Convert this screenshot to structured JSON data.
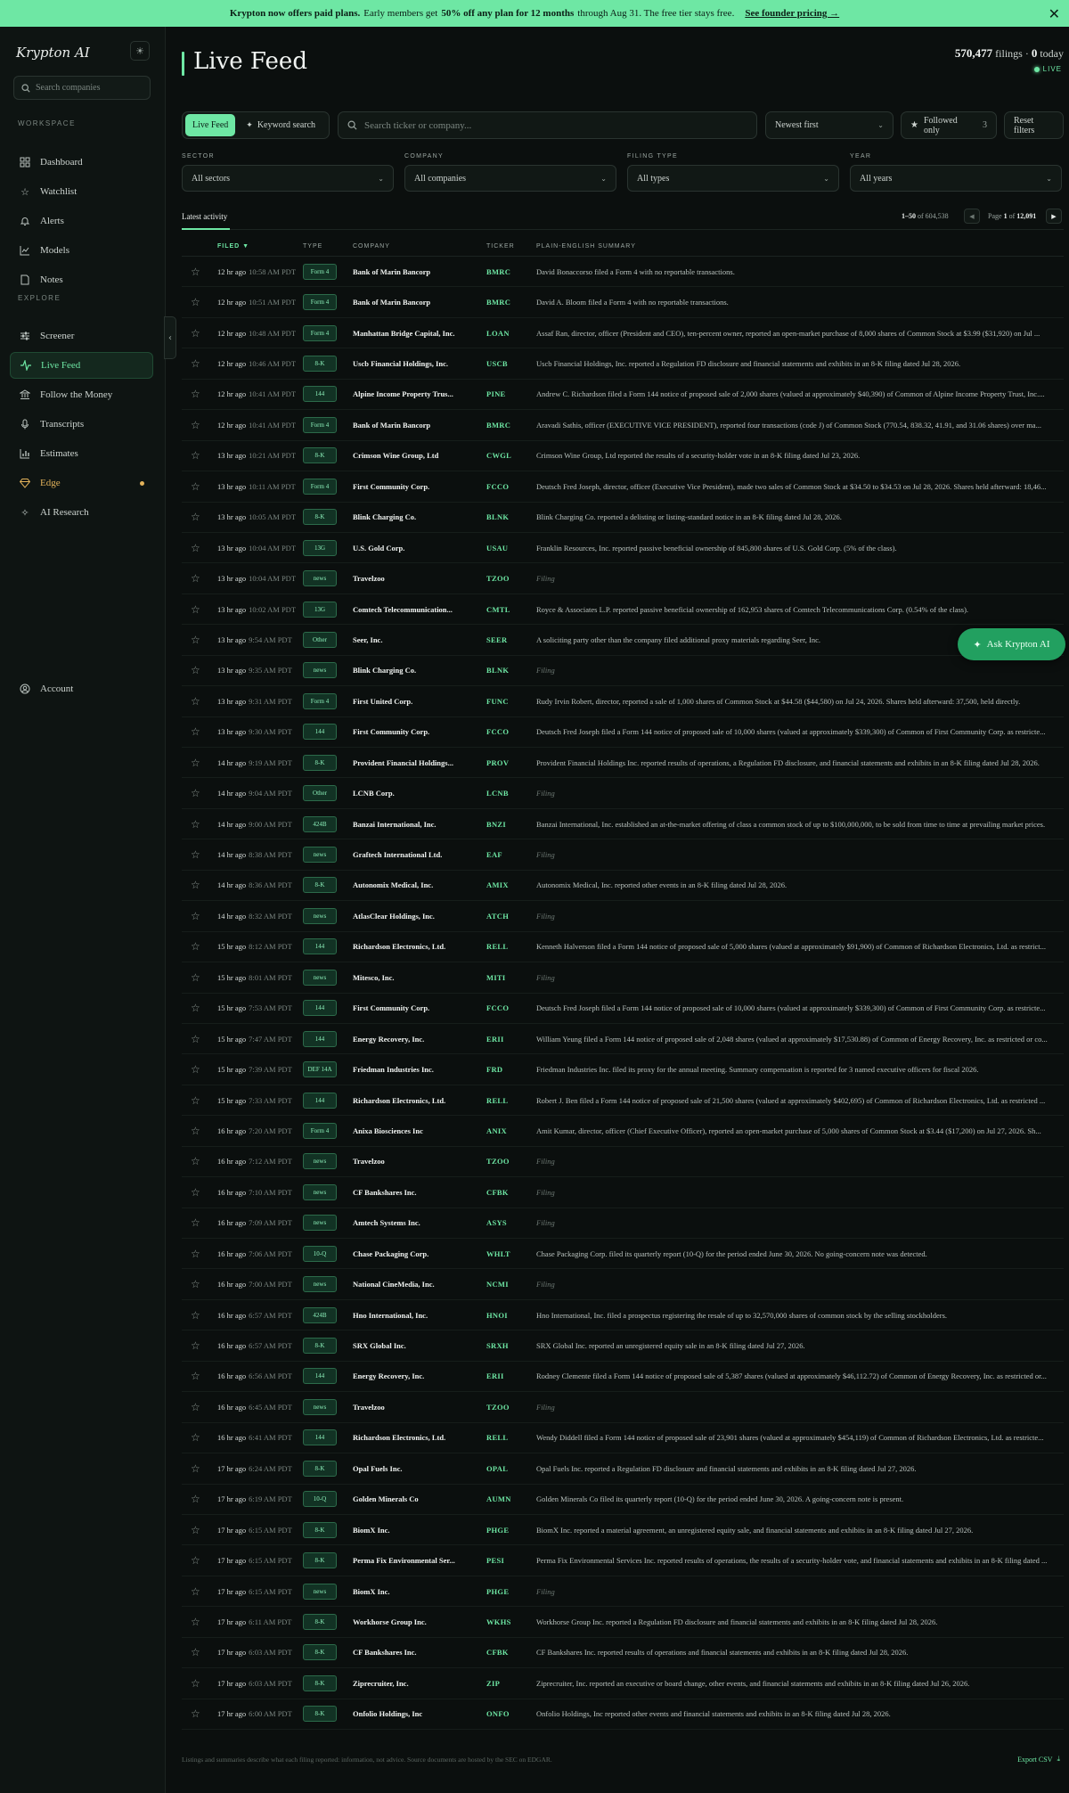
{
  "banner": {
    "lead": "Krypton now offers paid plans.",
    "text1": "Early members get",
    "highlight": "50% off any plan for 12 months",
    "text2": "through Aug 31. The free tier stays free.",
    "link": "See founder pricing →",
    "close": "✕"
  },
  "sidebar": {
    "logo": "Krypton AI",
    "search_placeholder": "Search companies",
    "workspace_label": "WORKSPACE",
    "explore_label": "EXPLORE",
    "workspace": [
      {
        "label": "Dashboard",
        "icon": "grid-icon"
      },
      {
        "label": "Watchlist",
        "icon": "star-icon"
      },
      {
        "label": "Alerts",
        "icon": "bell-icon"
      },
      {
        "label": "Models",
        "icon": "chart-line-icon"
      },
      {
        "label": "Notes",
        "icon": "note-icon"
      }
    ],
    "explore": [
      {
        "label": "Screener",
        "icon": "sliders-icon"
      },
      {
        "label": "Live Feed",
        "icon": "pulse-icon"
      },
      {
        "label": "Follow the Money",
        "icon": "bank-icon"
      },
      {
        "label": "Transcripts",
        "icon": "mic-icon"
      },
      {
        "label": "Estimates",
        "icon": "bar-chart-icon"
      },
      {
        "label": "Edge",
        "icon": "gem-icon"
      },
      {
        "label": "AI Research",
        "icon": "sparkle-icon"
      }
    ],
    "account": "Account"
  },
  "header": {
    "title": "Live Feed",
    "filings_count": "570,477",
    "filings_label": "filings ·",
    "today_count": "0",
    "today_label": "today",
    "live": "LIVE"
  },
  "toolbar": {
    "tab_live": "Live Feed",
    "tab_keyword": "Keyword search",
    "search_placeholder": "Search ticker or company...",
    "sort": "Newest first",
    "followed": "Followed only",
    "followed_count": "3",
    "reset": "Reset filters"
  },
  "filters": [
    {
      "label": "SECTOR",
      "value": "All sectors"
    },
    {
      "label": "COMPANY",
      "value": "All companies"
    },
    {
      "label": "FILING TYPE",
      "value": "All types"
    },
    {
      "label": "YEAR",
      "value": "All years"
    }
  ],
  "activity": {
    "tab": "Latest activity",
    "range": "1–50",
    "of_label": "of",
    "total": "604,538",
    "page_label": "Page",
    "page": "1",
    "pages": "12,091"
  },
  "table": {
    "headers": {
      "filed": "FILED ▼",
      "type": "TYPE",
      "company": "COMPANY",
      "ticker": "TICKER",
      "summary": "PLAIN-ENGLISH SUMMARY"
    },
    "rows": [
      {
        "ago": "12 hr ago",
        "time": "10:58 AM PDT",
        "type": "Form 4",
        "company": "Bank of Marin Bancorp",
        "ticker": "BMRC",
        "summary": "David Bonaccorso filed a Form 4 with no reportable transactions."
      },
      {
        "ago": "12 hr ago",
        "time": "10:51 AM PDT",
        "type": "Form 4",
        "company": "Bank of Marin Bancorp",
        "ticker": "BMRC",
        "summary": "David A. Bloom filed a Form 4 with no reportable transactions."
      },
      {
        "ago": "12 hr ago",
        "time": "10:48 AM PDT",
        "type": "Form 4",
        "company": "Manhattan Bridge Capital, Inc.",
        "ticker": "LOAN",
        "summary": "Assaf Ran, director, officer (President and CEO), ten-percent owner, reported an open-market purchase of 8,000 shares of Common Stock at $3.99 ($31,920) on Jul ..."
      },
      {
        "ago": "12 hr ago",
        "time": "10:46 AM PDT",
        "type": "8-K",
        "company": "Uscb Financial Holdings, Inc.",
        "ticker": "USCB",
        "summary": "Uscb Financial Holdings, Inc. reported a Regulation FD disclosure and financial statements and exhibits in an 8-K filing dated Jul 28, 2026."
      },
      {
        "ago": "12 hr ago",
        "time": "10:41 AM PDT",
        "type": "144",
        "company": "Alpine Income Property Trus...",
        "ticker": "PINE",
        "summary": "Andrew C. Richardson filed a Form 144 notice of proposed sale of 2,000 shares (valued at approximately $40,390) of Common of Alpine Income Property Trust, Inc...."
      },
      {
        "ago": "12 hr ago",
        "time": "10:41 AM PDT",
        "type": "Form 4",
        "company": "Bank of Marin Bancorp",
        "ticker": "BMRC",
        "summary": "Aravadi Sathis, officer (EXECUTIVE VICE PRESIDENT), reported four transactions (code J) of Common Stock (770.54, 838.32, 41.91, and 31.06 shares) over ma..."
      },
      {
        "ago": "13 hr ago",
        "time": "10:21 AM PDT",
        "type": "8-K",
        "company": "Crimson Wine Group, Ltd",
        "ticker": "CWGL",
        "summary": "Crimson Wine Group, Ltd reported the results of a security-holder vote in an 8-K filing dated Jul 23, 2026."
      },
      {
        "ago": "13 hr ago",
        "time": "10:11 AM PDT",
        "type": "Form 4",
        "company": "First Community Corp.",
        "ticker": "FCCO",
        "summary": "Deutsch Fred Joseph, director, officer (Executive Vice President), made two sales of Common Stock at $34.50 to $34.53 on Jul 28, 2026. Shares held afterward: 18,46..."
      },
      {
        "ago": "13 hr ago",
        "time": "10:05 AM PDT",
        "type": "8-K",
        "company": "Blink Charging Co.",
        "ticker": "BLNK",
        "summary": "Blink Charging Co. reported a delisting or listing-standard notice in an 8-K filing dated Jul 28, 2026."
      },
      {
        "ago": "13 hr ago",
        "time": "10:04 AM PDT",
        "type": "13G",
        "company": "U.S. Gold Corp.",
        "ticker": "USAU",
        "summary": "Franklin Resources, Inc. reported passive beneficial ownership of 845,800 shares of U.S. Gold Corp. (5% of the class)."
      },
      {
        "ago": "13 hr ago",
        "time": "10:04 AM PDT",
        "type": "news",
        "company": "Travelzoo",
        "ticker": "TZOO",
        "summary": "Filing"
      },
      {
        "ago": "13 hr ago",
        "time": "10:02 AM PDT",
        "type": "13G",
        "company": "Comtech Telecommunication...",
        "ticker": "CMTL",
        "summary": "Royce & Associates L.P. reported passive beneficial ownership of 162,953 shares of Comtech Telecommunications Corp. (0.54% of the class)."
      },
      {
        "ago": "13 hr ago",
        "time": "9:54 AM PDT",
        "type": "Other",
        "company": "Seer, Inc.",
        "ticker": "SEER",
        "summary": "A soliciting party other than the company filed additional proxy materials regarding Seer, Inc."
      },
      {
        "ago": "13 hr ago",
        "time": "9:35 AM PDT",
        "type": "news",
        "company": "Blink Charging Co.",
        "ticker": "BLNK",
        "summary": "Filing"
      },
      {
        "ago": "13 hr ago",
        "time": "9:31 AM PDT",
        "type": "Form 4",
        "company": "First United Corp.",
        "ticker": "FUNC",
        "summary": "Rudy Irvin Robert, director, reported a sale of 1,000 shares of Common Stock at $44.58 ($44,580) on Jul 24, 2026. Shares held afterward: 37,500, held directly."
      },
      {
        "ago": "13 hr ago",
        "time": "9:30 AM PDT",
        "type": "144",
        "company": "First Community Corp.",
        "ticker": "FCCO",
        "summary": "Deutsch Fred Joseph filed a Form 144 notice of proposed sale of 10,000 shares (valued at approximately $339,300) of Common of First Community Corp. as restricte..."
      },
      {
        "ago": "14 hr ago",
        "time": "9:19 AM PDT",
        "type": "8-K",
        "company": "Provident Financial Holdings...",
        "ticker": "PROV",
        "summary": "Provident Financial Holdings Inc. reported results of operations, a Regulation FD disclosure, and financial statements and exhibits in an 8-K filing dated Jul 28, 2026."
      },
      {
        "ago": "14 hr ago",
        "time": "9:04 AM PDT",
        "type": "Other",
        "company": "LCNB Corp.",
        "ticker": "LCNB",
        "summary": "Filing"
      },
      {
        "ago": "14 hr ago",
        "time": "9:00 AM PDT",
        "type": "424B",
        "company": "Banzai International, Inc.",
        "ticker": "BNZI",
        "summary": "Banzai International, Inc. established an at-the-market offering of class a common stock of up to $100,000,000, to be sold from time to time at prevailing market prices."
      },
      {
        "ago": "14 hr ago",
        "time": "8:38 AM PDT",
        "type": "news",
        "company": "Graftech International Ltd.",
        "ticker": "EAF",
        "summary": "Filing"
      },
      {
        "ago": "14 hr ago",
        "time": "8:36 AM PDT",
        "type": "8-K",
        "company": "Autonomix Medical, Inc.",
        "ticker": "AMIX",
        "summary": "Autonomix Medical, Inc. reported other events in an 8-K filing dated Jul 28, 2026."
      },
      {
        "ago": "14 hr ago",
        "time": "8:32 AM PDT",
        "type": "news",
        "company": "AtlasClear Holdings, Inc.",
        "ticker": "ATCH",
        "summary": "Filing"
      },
      {
        "ago": "15 hr ago",
        "time": "8:12 AM PDT",
        "type": "144",
        "company": "Richardson Electronics, Ltd.",
        "ticker": "RELL",
        "summary": "Kenneth Halverson filed a Form 144 notice of proposed sale of 5,000 shares (valued at approximately $91,900) of Common of Richardson Electronics, Ltd. as restrict..."
      },
      {
        "ago": "15 hr ago",
        "time": "8:01 AM PDT",
        "type": "news",
        "company": "Mitesco, Inc.",
        "ticker": "MITI",
        "summary": "Filing"
      },
      {
        "ago": "15 hr ago",
        "time": "7:53 AM PDT",
        "type": "144",
        "company": "First Community Corp.",
        "ticker": "FCCO",
        "summary": "Deutsch Fred Joseph filed a Form 144 notice of proposed sale of 10,000 shares (valued at approximately $339,300) of Common of First Community Corp. as restricte..."
      },
      {
        "ago": "15 hr ago",
        "time": "7:47 AM PDT",
        "type": "144",
        "company": "Energy Recovery, Inc.",
        "ticker": "ERII",
        "summary": "William Yeung filed a Form 144 notice of proposed sale of 2,048 shares (valued at approximately $17,530.88) of Common of Energy Recovery, Inc. as restricted or co..."
      },
      {
        "ago": "15 hr ago",
        "time": "7:39 AM PDT",
        "type": "DEF 14A",
        "company": "Friedman Industries Inc.",
        "ticker": "FRD",
        "summary": "Friedman Industries Inc. filed its proxy for the annual meeting. Summary compensation is reported for 3 named executive officers for fiscal 2026."
      },
      {
        "ago": "15 hr ago",
        "time": "7:33 AM PDT",
        "type": "144",
        "company": "Richardson Electronics, Ltd.",
        "ticker": "RELL",
        "summary": "Robert J. Ben filed a Form 144 notice of proposed sale of 21,500 shares (valued at approximately $402,695) of Common of Richardson Electronics, Ltd. as restricted ..."
      },
      {
        "ago": "16 hr ago",
        "time": "7:20 AM PDT",
        "type": "Form 4",
        "company": "Anixa Biosciences Inc",
        "ticker": "ANIX",
        "summary": "Amit Kumar, director, officer (Chief Executive Officer), reported an open-market purchase of 5,000 shares of Common Stock at $3.44 ($17,200) on Jul 27, 2026. Sh..."
      },
      {
        "ago": "16 hr ago",
        "time": "7:12 AM PDT",
        "type": "news",
        "company": "Travelzoo",
        "ticker": "TZOO",
        "summary": "Filing"
      },
      {
        "ago": "16 hr ago",
        "time": "7:10 AM PDT",
        "type": "news",
        "company": "CF Bankshares Inc.",
        "ticker": "CFBK",
        "summary": "Filing"
      },
      {
        "ago": "16 hr ago",
        "time": "7:09 AM PDT",
        "type": "news",
        "company": "Amtech Systems Inc.",
        "ticker": "ASYS",
        "summary": "Filing"
      },
      {
        "ago": "16 hr ago",
        "time": "7:06 AM PDT",
        "type": "10-Q",
        "company": "Chase Packaging Corp.",
        "ticker": "WHLT",
        "summary": "Chase Packaging Corp. filed its quarterly report (10-Q) for the period ended June 30, 2026. No going-concern note was detected."
      },
      {
        "ago": "16 hr ago",
        "time": "7:00 AM PDT",
        "type": "news",
        "company": "National CineMedia, Inc.",
        "ticker": "NCMI",
        "summary": "Filing"
      },
      {
        "ago": "16 hr ago",
        "time": "6:57 AM PDT",
        "type": "424B",
        "company": "Hno International, Inc.",
        "ticker": "HNOI",
        "summary": "Hno International, Inc. filed a prospectus registering the resale of up to 32,570,000 shares of common stock by the selling stockholders."
      },
      {
        "ago": "16 hr ago",
        "time": "6:57 AM PDT",
        "type": "8-K",
        "company": "SRX Global Inc.",
        "ticker": "SRXH",
        "summary": "SRX Global Inc. reported an unregistered equity sale in an 8-K filing dated Jul 27, 2026."
      },
      {
        "ago": "16 hr ago",
        "time": "6:56 AM PDT",
        "type": "144",
        "company": "Energy Recovery, Inc.",
        "ticker": "ERII",
        "summary": "Rodney Clemente filed a Form 144 notice of proposed sale of 5,387 shares (valued at approximately $46,112.72) of Common of Energy Recovery, Inc. as restricted or..."
      },
      {
        "ago": "16 hr ago",
        "time": "6:45 AM PDT",
        "type": "news",
        "company": "Travelzoo",
        "ticker": "TZOO",
        "summary": "Filing"
      },
      {
        "ago": "16 hr ago",
        "time": "6:41 AM PDT",
        "type": "144",
        "company": "Richardson Electronics, Ltd.",
        "ticker": "RELL",
        "summary": "Wendy Diddell filed a Form 144 notice of proposed sale of 23,901 shares (valued at approximately $454,119) of Common of Richardson Electronics, Ltd. as restricte..."
      },
      {
        "ago": "17 hr ago",
        "time": "6:24 AM PDT",
        "type": "8-K",
        "company": "Opal Fuels Inc.",
        "ticker": "OPAL",
        "summary": "Opal Fuels Inc. reported a Regulation FD disclosure and financial statements and exhibits in an 8-K filing dated Jul 27, 2026."
      },
      {
        "ago": "17 hr ago",
        "time": "6:19 AM PDT",
        "type": "10-Q",
        "company": "Golden Minerals Co",
        "ticker": "AUMN",
        "summary": "Golden Minerals Co filed its quarterly report (10-Q) for the period ended June 30, 2026. A going-concern note is present."
      },
      {
        "ago": "17 hr ago",
        "time": "6:15 AM PDT",
        "type": "8-K",
        "company": "BiomX Inc.",
        "ticker": "PHGE",
        "summary": "BiomX Inc. reported a material agreement, an unregistered equity sale, and financial statements and exhibits in an 8-K filing dated Jul 27, 2026."
      },
      {
        "ago": "17 hr ago",
        "time": "6:15 AM PDT",
        "type": "8-K",
        "company": "Perma Fix Environmental Ser...",
        "ticker": "PESI",
        "summary": "Perma Fix Environmental Services Inc. reported results of operations, the results of a security-holder vote, and financial statements and exhibits in an 8-K filing dated ..."
      },
      {
        "ago": "17 hr ago",
        "time": "6:15 AM PDT",
        "type": "news",
        "company": "BiomX Inc.",
        "ticker": "PHGE",
        "summary": "Filing"
      },
      {
        "ago": "17 hr ago",
        "time": "6:11 AM PDT",
        "type": "8-K",
        "company": "Workhorse Group Inc.",
        "ticker": "WKHS",
        "summary": "Workhorse Group Inc. reported a Regulation FD disclosure and financial statements and exhibits in an 8-K filing dated Jul 28, 2026."
      },
      {
        "ago": "17 hr ago",
        "time": "6:03 AM PDT",
        "type": "8-K",
        "company": "CF Bankshares Inc.",
        "ticker": "CFBK",
        "summary": "CF Bankshares Inc. reported results of operations and financial statements and exhibits in an 8-K filing dated Jul 28, 2026."
      },
      {
        "ago": "17 hr ago",
        "time": "6:03 AM PDT",
        "type": "8-K",
        "company": "Ziprecruiter, Inc.",
        "ticker": "ZIP",
        "summary": "Ziprecruiter, Inc. reported an executive or board change, other events, and financial statements and exhibits in an 8-K filing dated Jul 26, 2026."
      },
      {
        "ago": "17 hr ago",
        "time": "6:00 AM PDT",
        "type": "8-K",
        "company": "Onfolio Holdings, Inc",
        "ticker": "ONFO",
        "summary": "Onfolio Holdings, Inc reported other events and financial statements and exhibits in an 8-K filing dated Jul 28, 2026."
      }
    ]
  },
  "ask_button": "Ask Krypton AI",
  "footer": {
    "note": "Listings and summaries describe what each filing reported: information, not advice. Source documents are hosted by the SEC on EDGAR.",
    "export": "Export CSV"
  }
}
